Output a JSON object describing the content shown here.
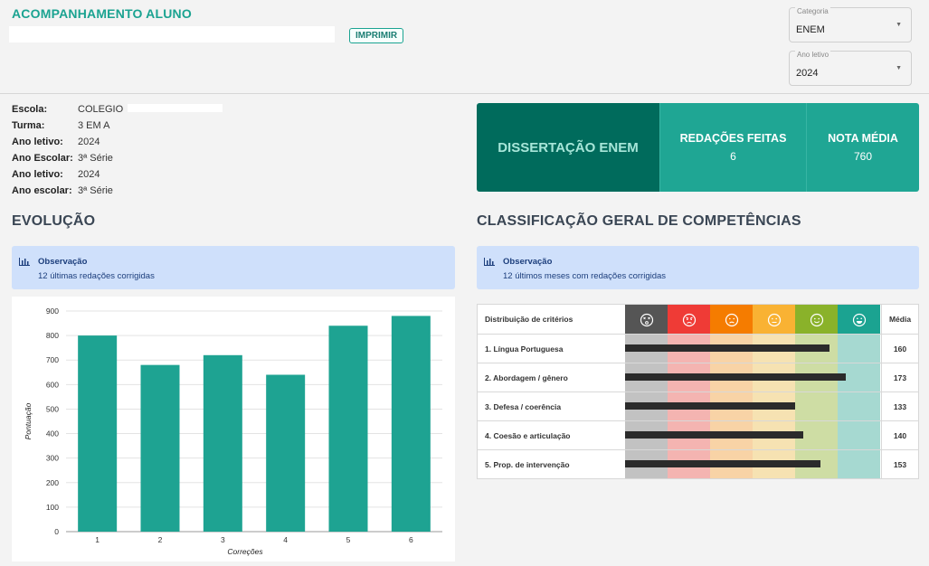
{
  "header": {
    "title": "ACOMPANHAMENTO ALUNO",
    "print_label": "IMPRIMIR"
  },
  "filters": {
    "categoria": {
      "label": "Categoria",
      "value": "ENEM"
    },
    "ano_letivo": {
      "label": "Ano letivo",
      "value": "2024"
    }
  },
  "student_info": [
    {
      "key": "Escola:",
      "value": "COLEGIO"
    },
    {
      "key": "Turma:",
      "value": "3 EM A"
    },
    {
      "key": "Ano letivo:",
      "value": "2024"
    },
    {
      "key": "Ano Escolar:",
      "value": "3ª Série"
    },
    {
      "key": "Ano letivo:",
      "value": "2024"
    },
    {
      "key": "Ano escolar:",
      "value": "3ª Série"
    }
  ],
  "stats": {
    "main": "DISSERTAÇÃO ENEM",
    "redacoes_title": "REDAÇÕES FEITAS",
    "redacoes_value": "6",
    "nota_title": "NOTA MÉDIA",
    "nota_value": "760"
  },
  "evolucao": {
    "title": "EVOLUÇÃO",
    "obs_title": "Observação",
    "obs_text": "12 últimas redações corrigidas"
  },
  "competencias": {
    "title": "CLASSIFICAÇÃO GERAL DE COMPETÊNCIAS",
    "obs_title": "Observação",
    "obs_text": "12 últimos meses com redações corrigidas",
    "header_label": "Distribuição de critérios",
    "media_label": "Média",
    "columns": [
      {
        "icon": "dizzy-face-icon",
        "color": "#555555",
        "light": "#c2c2c2"
      },
      {
        "icon": "angry-face-icon",
        "color": "#ef3b36",
        "light": "#f4b4b1"
      },
      {
        "icon": "sad-face-icon",
        "color": "#f57c00",
        "light": "#f8d3a6"
      },
      {
        "icon": "neutral-face-icon",
        "color": "#f9b233",
        "light": "#f6e2b2"
      },
      {
        "icon": "smile-face-icon",
        "color": "#8ab22a",
        "light": "#cedda4"
      },
      {
        "icon": "grin-face-icon",
        "color": "#1ba391",
        "light": "#a6d9d1"
      }
    ],
    "rows": [
      {
        "label": "1. Língua Portuguesa",
        "value": 160
      },
      {
        "label": "2. Abordagem / gênero",
        "value": 173
      },
      {
        "label": "3. Defesa / coerência",
        "value": 133
      },
      {
        "label": "4. Coesão e articulação",
        "value": 140
      },
      {
        "label": "5. Prop. de intervenção",
        "value": 153
      }
    ]
  },
  "chart_data": {
    "type": "bar",
    "categories": [
      "1",
      "2",
      "3",
      "4",
      "5",
      "6"
    ],
    "values": [
      800,
      680,
      720,
      640,
      840,
      880
    ],
    "xlabel": "Correções",
    "ylabel": "Pontuação",
    "ylim": [
      0,
      900
    ],
    "yticks": [
      0,
      100,
      200,
      300,
      400,
      500,
      600,
      700,
      800,
      900
    ],
    "color": "#1ea392",
    "grid": true
  }
}
